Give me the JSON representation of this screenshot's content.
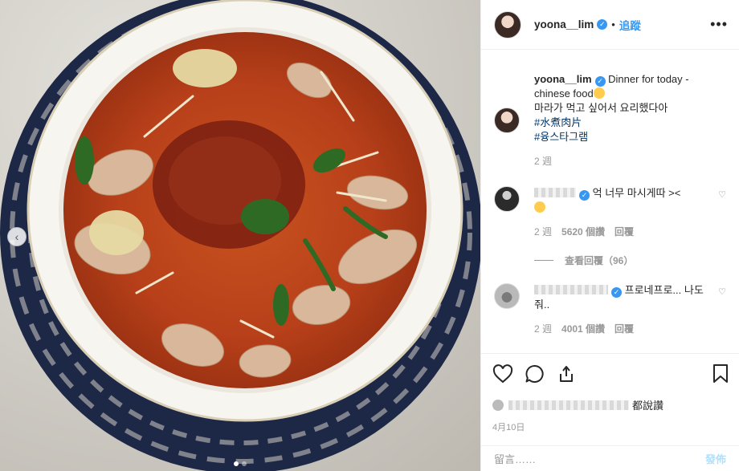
{
  "post": {
    "username": "yoona__lim",
    "follow_label": "追蹤",
    "more_label": "•••",
    "caption_text_en": "Dinner for today - chinese food",
    "caption_text_kr": "마라가 먹고 싶어서 요리했다아",
    "hashtags": [
      "#水煮肉片",
      "#융스타그램"
    ],
    "caption_age": "2 週"
  },
  "comments": [
    {
      "text": "억 너무 마시게따 ><",
      "age": "2 週",
      "likes": "5620 個讚",
      "reply_label": "回覆",
      "view_replies": "查看回覆（96）"
    },
    {
      "text": "프로네프로... 나도줘..",
      "age": "2 週",
      "likes": "4001 個讚",
      "reply_label": "回覆"
    }
  ],
  "actions": {
    "likes_suffix": "都說讚",
    "date": "4月10日"
  },
  "comment_box": {
    "placeholder": "留言……",
    "post_label": "發佈"
  },
  "carousel": {
    "slide_count": 2,
    "current": 1
  },
  "colors": {
    "accent": "#3897f0",
    "hashtag": "#003569",
    "muted": "#999999"
  }
}
